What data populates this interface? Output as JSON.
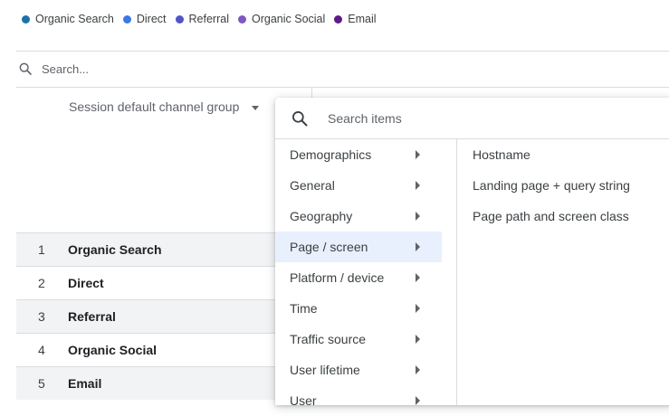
{
  "legend": [
    {
      "label": "Organic Search",
      "color": "#1a73a8"
    },
    {
      "label": "Direct",
      "color": "#3b78e7"
    },
    {
      "label": "Referral",
      "color": "#4f54c9"
    },
    {
      "label": "Organic Social",
      "color": "#7e57c2"
    },
    {
      "label": "Email",
      "color": "#5c1a8a"
    }
  ],
  "table_search": {
    "placeholder": "Search..."
  },
  "column_header": {
    "label": "Session default channel group"
  },
  "rows": [
    {
      "num": "1",
      "name": "Organic Search"
    },
    {
      "num": "2",
      "name": "Direct"
    },
    {
      "num": "3",
      "name": "Referral"
    },
    {
      "num": "4",
      "name": "Organic Social"
    },
    {
      "num": "5",
      "name": "Email"
    }
  ],
  "menu": {
    "search_placeholder": "Search items",
    "categories": [
      "Demographics",
      "General",
      "Geography",
      "Page / screen",
      "Platform / device",
      "Time",
      "Traffic source",
      "User lifetime",
      "User"
    ],
    "active_category": "Page / screen",
    "items": [
      "Hostname",
      "Landing page + query string",
      "Page path and screen class"
    ]
  }
}
